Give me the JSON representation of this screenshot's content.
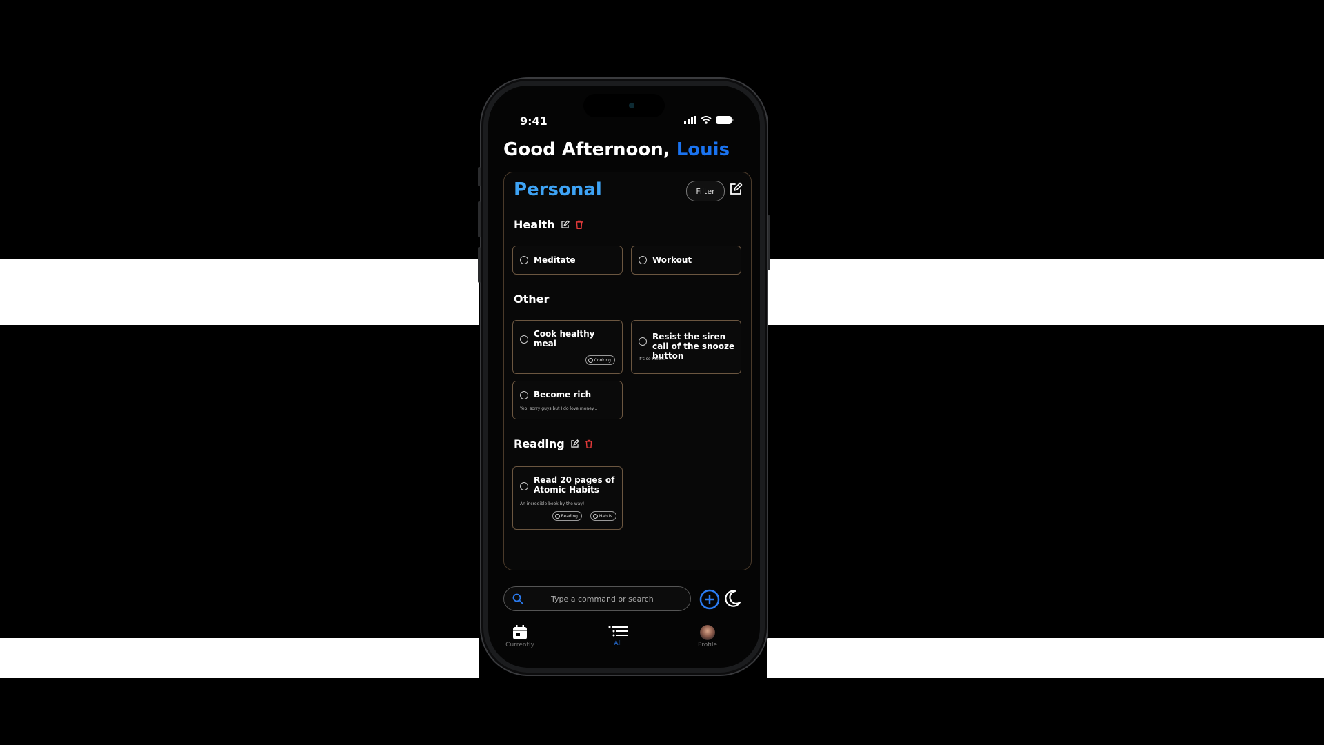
{
  "status": {
    "time": "9:41"
  },
  "header": {
    "greeting": "Good Afternoon,",
    "name": "Louis"
  },
  "panel": {
    "title": "Personal",
    "filter_label": "Filter"
  },
  "sections": {
    "health": {
      "label": "Health",
      "cards": [
        {
          "title": "Meditate"
        },
        {
          "title": "Workout"
        }
      ]
    },
    "other": {
      "label": "Other",
      "cards": [
        {
          "title": "Cook healthy meal preparations for the...",
          "tags": [
            "Cooking"
          ]
        },
        {
          "title": "Resist the siren call of the snooze button",
          "note": "It's so hard..."
        },
        {
          "title": "Become rich",
          "note": "Yep, sorry guys but I do love money..."
        }
      ]
    },
    "reading": {
      "label": "Reading",
      "cards": [
        {
          "title": "Read 20 pages of Atomic Habits",
          "note": "An incredible book by the way!",
          "tags": [
            "Reading",
            "Habits"
          ]
        }
      ]
    }
  },
  "search": {
    "placeholder": "Type a command or search"
  },
  "tabbar": {
    "items": [
      {
        "label": "Currently",
        "icon": "calendar-icon"
      },
      {
        "label": "All",
        "icon": "list-icon"
      },
      {
        "label": "Profile",
        "icon": "avatar"
      }
    ]
  },
  "colors": {
    "accent": "#1a73f0",
    "title_blue": "#3ea3f5",
    "delete_red": "#e23a3a",
    "card_border": "#6b5640"
  }
}
